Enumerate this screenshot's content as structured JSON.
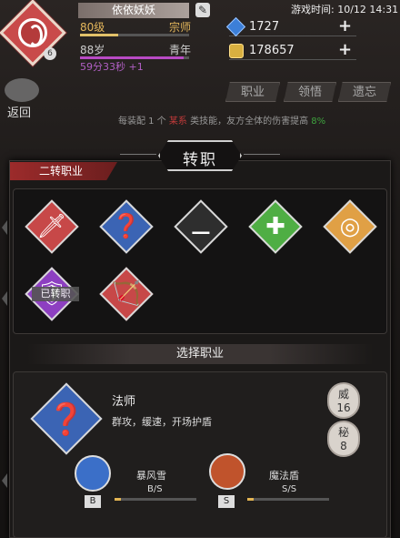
{
  "header": {
    "player_name": "依依妖妖",
    "avatar_level": "6",
    "level": "80级",
    "rank": "宗师",
    "age": "88岁",
    "stage": "青年",
    "timer": "59分33秒 +1",
    "edit_icon": "✎"
  },
  "status": {
    "game_time": "游戏时间: 10/12 14:31"
  },
  "resources": [
    {
      "icon": "gem-icon",
      "value": "1727",
      "plus": "+"
    },
    {
      "icon": "coin-icon",
      "value": "178657",
      "plus": "+"
    }
  ],
  "nav": {
    "back_label": "返回",
    "tabs": [
      "职业",
      "领悟",
      "遗忘"
    ]
  },
  "info": {
    "prefix": "每装配 1 个",
    "highlight": "某系",
    "middle": "类技能，友方全体的伤害提高",
    "value": "8%"
  },
  "panel": {
    "title": "转职",
    "section_tab": "二转职业",
    "jobs": [
      {
        "icon": "sword-icon",
        "glyph": "🗡",
        "color": "#c74848"
      },
      {
        "icon": "staff-icon",
        "glyph": "❓",
        "color": "#3b64b4"
      },
      {
        "icon": "scroll-icon",
        "glyph": "⚊",
        "color": "#2e2e2e"
      },
      {
        "icon": "cross-icon",
        "glyph": "✚",
        "color": "#4fae44"
      },
      {
        "icon": "ring-icon",
        "glyph": "◎",
        "color": "#e0a045"
      },
      {
        "icon": "shield-icon",
        "glyph": "🛡",
        "color": "#8d3fc1"
      },
      {
        "icon": "bow-icon",
        "glyph": "🏹",
        "color": "#c74848"
      }
    ],
    "job_tag": "已转职",
    "select_title": "选择职业",
    "selected": {
      "name": "法师",
      "desc": "群攻，缓速，开场护盾",
      "stats": [
        {
          "key": "威",
          "value": "16"
        },
        {
          "key": "秘",
          "value": "8"
        }
      ],
      "skills": [
        {
          "name": "暴风雪",
          "badge": "B",
          "grade": "B/S",
          "icon": "blizzard-icon",
          "color": "#3b6fc8"
        },
        {
          "name": "魔法盾",
          "badge": "S",
          "grade": "S/S",
          "icon": "magic-shield-icon",
          "color": "#c0532c"
        }
      ]
    }
  }
}
